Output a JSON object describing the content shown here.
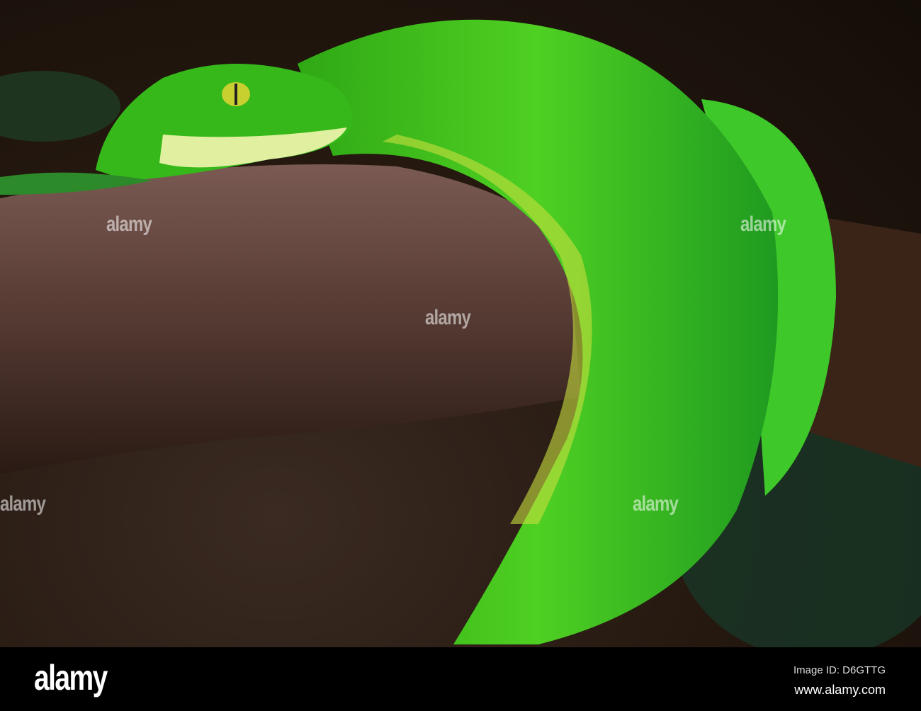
{
  "photo": {
    "watermark_text": "alamy",
    "colors": {
      "snake": "#3fc21e",
      "snake_light": "#8fe040",
      "branch": "#5a3d35",
      "background": "#24180f"
    }
  },
  "footer": {
    "logo": "alamy",
    "image_id": "Image ID: D6GTTG",
    "url": "www.alamy.com"
  }
}
